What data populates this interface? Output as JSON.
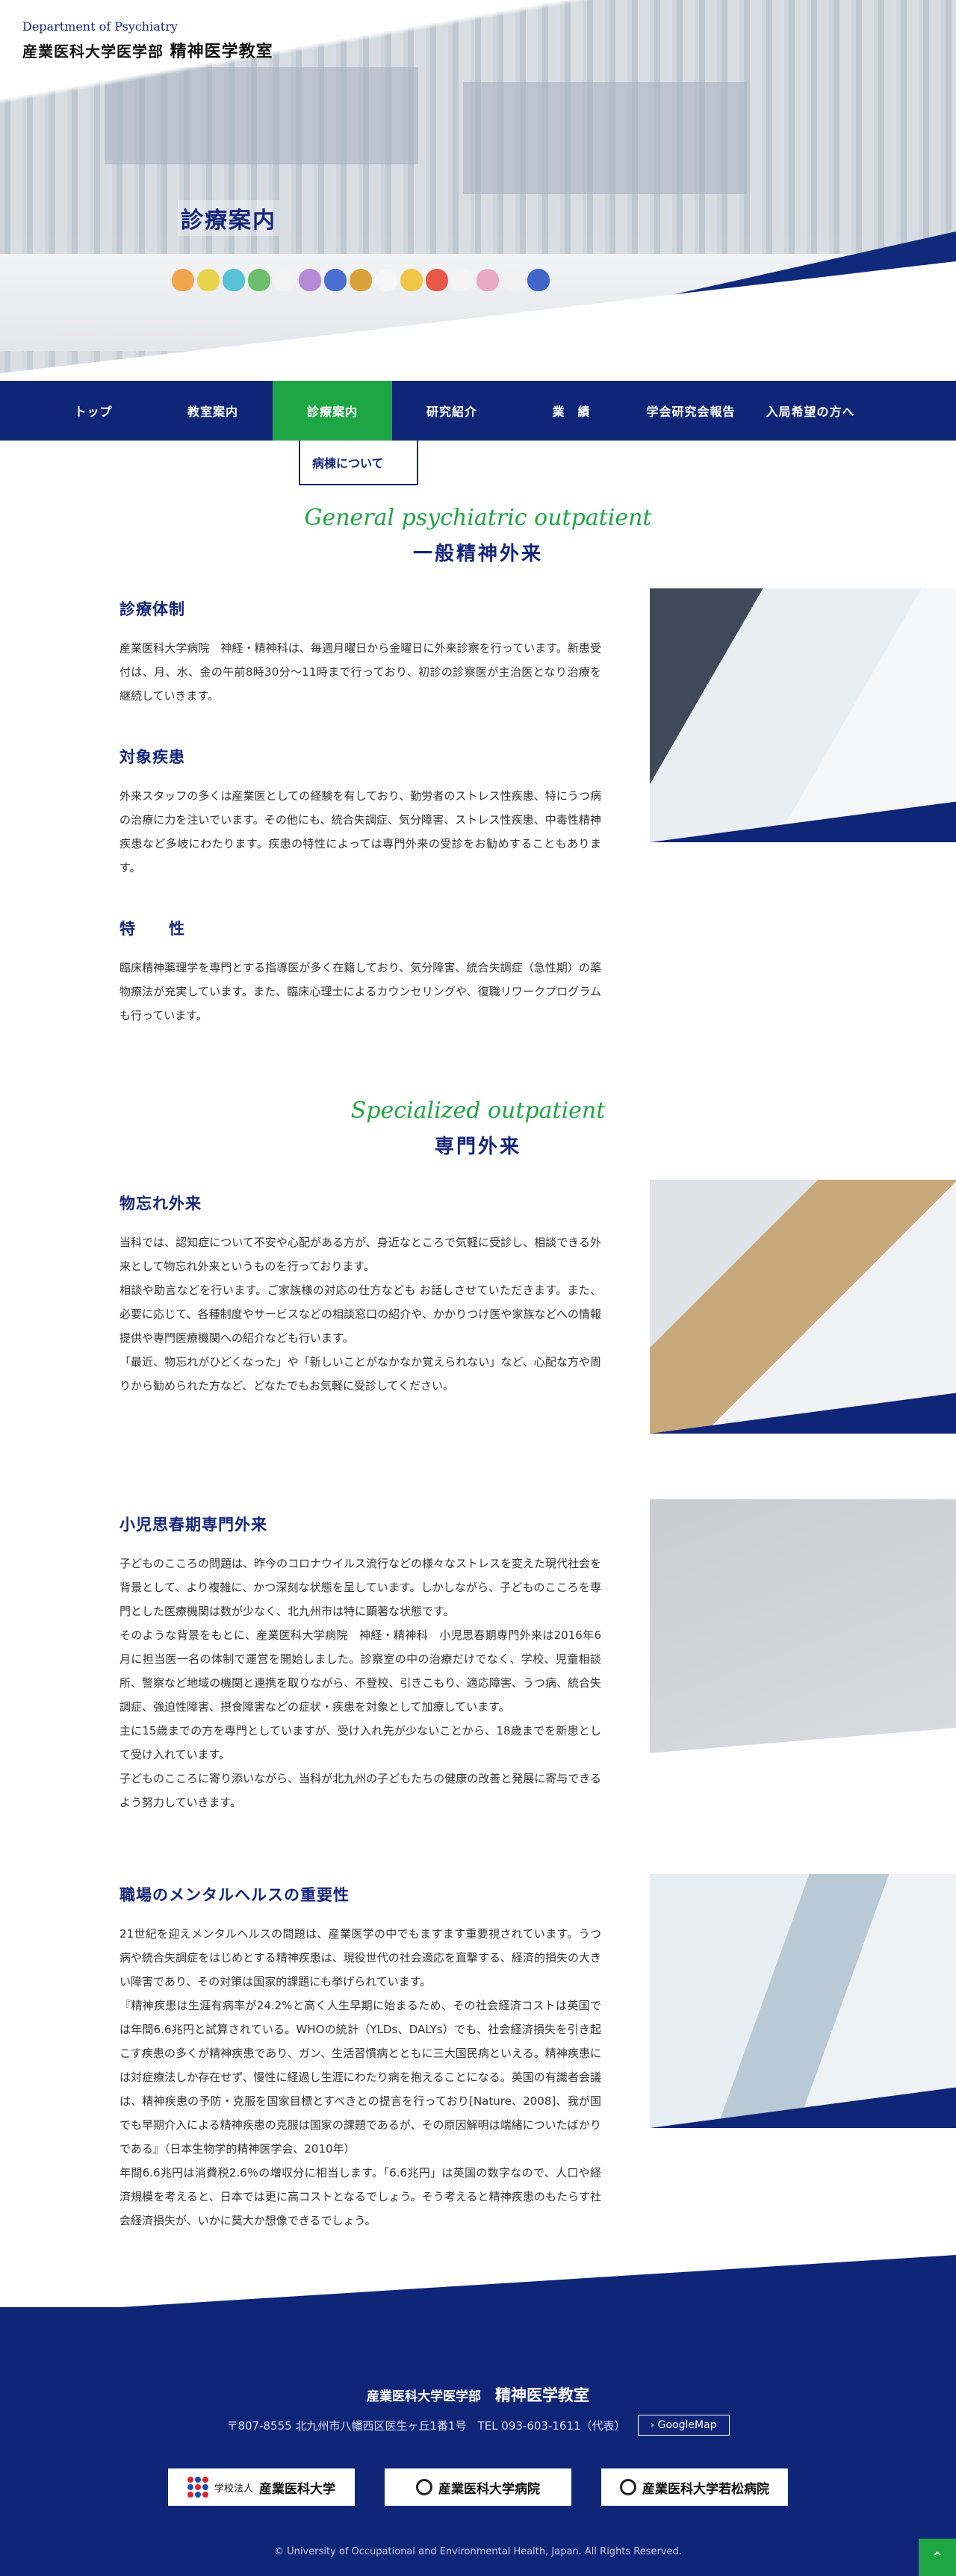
{
  "header": {
    "dept_en": "Department of Psychiatry",
    "univ_ja": "産業医科大学医学部",
    "dept_ja": "精神医学教室",
    "page_title": "診療案内"
  },
  "nav": {
    "items": [
      {
        "label": "トップ"
      },
      {
        "label": "教室案内"
      },
      {
        "label": "診療案内"
      },
      {
        "label": "研究紹介"
      },
      {
        "label": "業　績"
      },
      {
        "label": "学会研究会報告"
      },
      {
        "label": "入局希望の方へ"
      }
    ],
    "active_index": 2,
    "submenu": {
      "label": "病棟について"
    }
  },
  "general": {
    "title_en": "General psychiatric outpatient",
    "title_ja": "一般精神外来",
    "items": [
      {
        "heading": "診療体制",
        "text": "産業医科大学病院　神経・精神科は、毎週月曜日から金曜日に外来診察を行っています。新患受付は、月、水、金の午前8時30分〜11時まで行っており、初診の診察医が主治医となり治療を継続していきます。"
      },
      {
        "heading": "対象疾患",
        "text": "外来スタッフの多くは産業医としての経験を有しており、勤労者のストレス性疾患、特にうつ病の治療に力を注いでいます。その他にも、統合失調症、気分障害、ストレス性疾患、中毒性精神疾患など多岐にわたります。疾患の特性によっては専門外来の受診をお勧めすることもあります。"
      },
      {
        "heading": "特　　性",
        "text": "臨床精神薬理学を専門とする指導医が多く在籍しており、気分障害、統合失調症（急性期）の薬物療法が充実しています。また、臨床心理士によるカウンセリングや、復職リワークプログラムも行っています。"
      }
    ]
  },
  "specialized": {
    "title_en": "Specialized outpatient",
    "title_ja": "専門外来",
    "items": [
      {
        "heading": "物忘れ外来",
        "paragraphs": [
          "当科では、認知症について不安や心配がある方が、身近なところで気軽に受診し、相談できる外来として物忘れ外来というものを行っております。",
          "相談や助言などを行います。ご家族様の対応の仕方なども お話しさせていただきます。また、必要に応じて、各種制度やサービスなどの相談窓口の紹介や、かかりつけ医や家族などへの情報提供や専門医療機関への紹介なども行います。",
          "「最近、物忘れがひどくなった」や「新しいことがなかなか覚えられない」など、心配な方や周りから勧められた方など、どなたでもお気軽に受診してください。"
        ]
      },
      {
        "heading": "小児思春期専門外来",
        "paragraphs": [
          "子どものこころの問題は、昨今のコロナウイルス流行などの様々なストレスを変えた現代社会を背景として、より複雑に、かつ深刻な状態を呈しています。しかしながら、子どものこころを専門とした医療機関は数が少なく、北九州市は特に顕著な状態です。",
          "そのような背景をもとに、産業医科大学病院　神経・精神科　小児思春期専門外来は2016年6月に担当医一名の体制で運営を開始しました。診察室の中の治療だけでなく、学校、児童相談所、警察など地域の機関と連携を取りながら、不登校、引きこもり、適応障害、うつ病、統合失調症、強迫性障害、摂食障害などの症状・疾患を対象として加療しています。",
          "主に15歳までの方を専門としていますが、受け入れ先が少ないことから、18歳までを新患として受け入れています。",
          "子どものこころに寄り添いながら、当科が北九州の子どもたちの健康の改善と発展に寄与できるよう努力していきます。"
        ]
      },
      {
        "heading": "職場のメンタルヘルスの重要性",
        "paragraphs": [
          "21世紀を迎えメンタルヘルスの問題は、産業医学の中でもますます重要視されています。うつ病や統合失調症をはじめとする精神疾患は、現役世代の社会適応を直撃する、経済的損失の大きい障害であり、その対策は国家的課題にも挙げられています。",
          "『精神疾患は生涯有病率が24.2%と高く人生早期に始まるため、その社会経済コストは英国では年間6.6兆円と試算されている。WHOの統計（YLDs、DALYs）でも、社会経済損失を引き起こす疾患の多くが精神疾患であり、ガン、生活習慣病とともに三大国民病といえる。精神疾患には対症療法しか存在せず、慢性に経過し生涯にわたり病を抱えることになる。英国の有識者会議は、精神疾患の予防・克服を国家目標とすべきとの提言を行っており[Nature、2008]、我が国でも早期介入による精神疾患の克服は国家の課題であるが、その原因解明は端緒についたばかりである』（日本生物学的精神医学会、2010年）",
          "年間6.6兆円は消費税2.6％の増収分に相当します。「6.6兆円」は英国の数字なので、人口や経済規模を考えると、日本では更に高コストとなるでしょう。そう考えると精神疾患のもたらす社会経済損失が、いかに莫大か想像できるでしょう。"
        ]
      }
    ]
  },
  "footer": {
    "univ": "産業医科大学医学部",
    "dept": "精神医学教室",
    "address": "〒807-8555 北九州市八幡西区医生ヶ丘1番1号　TEL 093-603-1611（代表）",
    "gmap_label": "GoogleMap",
    "logos": [
      {
        "label": "産業医科大学",
        "prefix": "学校法人"
      },
      {
        "label": "産業医科大学病院"
      },
      {
        "label": "産業医科大学若松病院"
      }
    ],
    "copyright": "© University of Occupational and Environmental Health, Japan. All Rights Reserved."
  }
}
